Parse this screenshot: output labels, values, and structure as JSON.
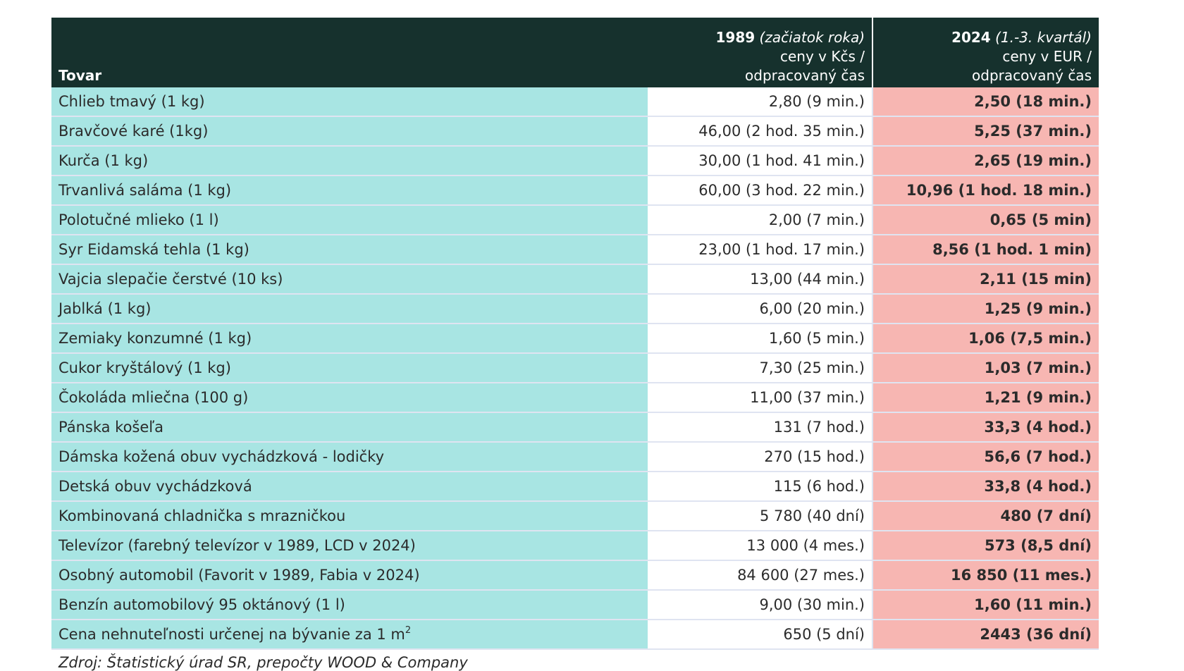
{
  "table": {
    "header": {
      "col_goods": "Tovar",
      "col_1989_year": "1989",
      "col_1989_note": "(začiatok roka)",
      "col_1989_line2": "ceny v Kčs /",
      "col_1989_line3": "odpracovaný čas",
      "col_2024_year": "2024",
      "col_2024_note": "(1.-3. kvartál)",
      "col_2024_line2": "ceny v EUR /",
      "col_2024_line3": "odpracovaný čas"
    },
    "rows": [
      {
        "item": "Chlieb tmavý (1 kg)",
        "v1989": "2,80 (9 min.)",
        "v2024": "2,50 (18 min.)"
      },
      {
        "item": "Bravčové karé (1kg)",
        "v1989": "46,00 (2 hod. 35 min.)",
        "v2024": "5,25 (37 min.)"
      },
      {
        "item": "Kurča (1 kg)",
        "v1989": "30,00 (1 hod. 41 min.)",
        "v2024": "2,65 (19 min.)"
      },
      {
        "item": "Trvanlivá saláma (1 kg)",
        "v1989": "60,00 (3 hod. 22 min.)",
        "v2024": "10,96 (1 hod. 18 min.)"
      },
      {
        "item": "Polotučné mlieko (1 l)",
        "v1989": "2,00 (7 min.)",
        "v2024": "0,65 (5 min)"
      },
      {
        "item": "Syr Eidamská tehla (1 kg)",
        "v1989": "23,00 (1 hod. 17 min.)",
        "v2024": "8,56 (1 hod. 1 min)"
      },
      {
        "item": "Vajcia slepačie čerstvé (10 ks)",
        "v1989": "13,00 (44 min.)",
        "v2024": "2,11 (15 min)"
      },
      {
        "item": "Jablká (1 kg)",
        "v1989": "6,00 (20 min.)",
        "v2024": "1,25 (9 min.)"
      },
      {
        "item": "Zemiaky konzumné (1 kg)",
        "v1989": "1,60 (5 min.)",
        "v2024": "1,06 (7,5 min.)"
      },
      {
        "item": "Cukor kryštálový (1 kg)",
        "v1989": "7,30 (25 min.)",
        "v2024": "1,03 (7 min.)"
      },
      {
        "item": "Čokoláda mliečna (100 g)",
        "v1989": "11,00 (37 min.)",
        "v2024": "1,21 (9 min.)"
      },
      {
        "item": "Pánska košeľa",
        "v1989": "131 (7 hod.)",
        "v2024": "33,3 (4 hod.)"
      },
      {
        "item": "Dámska kožená obuv vychádzková - lodičky",
        "v1989": "270 (15 hod.)",
        "v2024": "56,6 (7 hod.)"
      },
      {
        "item": "Detská obuv vychádzková",
        "v1989": "115 (6 hod.)",
        "v2024": "33,8 (4 hod.)"
      },
      {
        "item": "Kombinovaná chladnička s mrazničkou",
        "v1989": "5 780 (40 dní)",
        "v2024": "480 (7 dní)"
      },
      {
        "item": "Televízor (farebný televízor v 1989, LCD v 2024)",
        "v1989": "13 000 (4 mes.)",
        "v2024": "573 (8,5 dní)"
      },
      {
        "item": "Osobný automobil (Favorit v 1989, Fabia v 2024)",
        "v1989": "84 600 (27 mes.)",
        "v2024": "16 850 (11 mes.)"
      },
      {
        "item": "Benzín automobilový 95 oktánový (1 l)",
        "v1989": "9,00 (30 min.)",
        "v2024": "1,60 (11 min.)"
      },
      {
        "item": "Cena nehnuteľnosti určenej na bývanie za 1 m",
        "item_sup": "2",
        "v1989": "650 (5 dní)",
        "v2024": "2443 (36 dní)"
      }
    ]
  },
  "source": "Zdroj: Štatistický úrad SR, prepočty WOOD & Company",
  "colors": {
    "header_bg": "#16312d",
    "goods_bg": "#a8e5e3",
    "col_2024_bg": "#f7b6b2",
    "col_1989_bg": "#ffffff"
  }
}
